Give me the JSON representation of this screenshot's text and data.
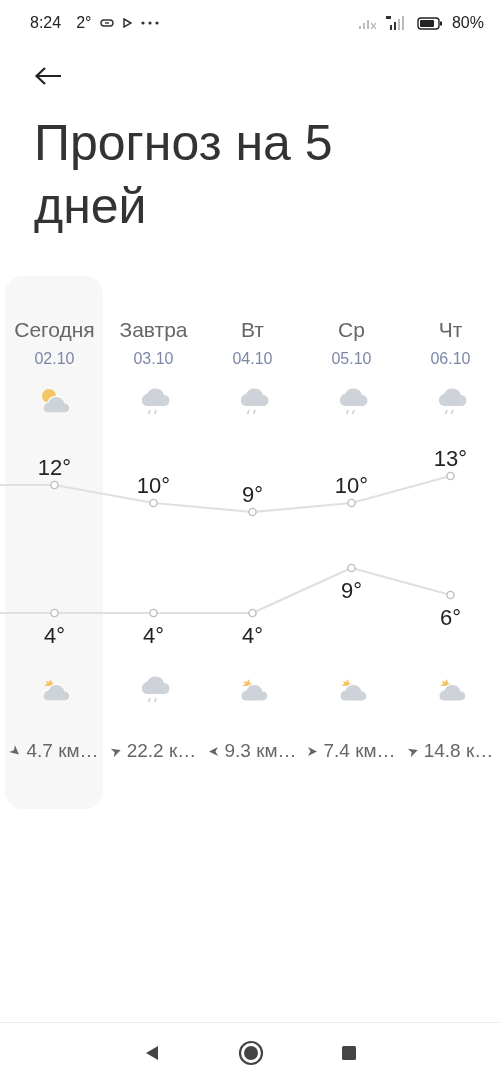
{
  "status_bar": {
    "time": "8:24",
    "temperature": "2°",
    "battery": "80%"
  },
  "title": "Прогноз на 5 дней",
  "days": [
    {
      "name": "Сегодня",
      "date": "02.10",
      "selected": true,
      "high": "12°",
      "low": "4°",
      "day_icon": {
        "kind": "sun-cloud"
      },
      "night_icon": {
        "kind": "night-cloud"
      },
      "wind": "4.7 км…",
      "wind_arrow": {
        "kind": "se"
      }
    },
    {
      "name": "Завтра",
      "date": "03.10",
      "selected": false,
      "high": "10°",
      "low": "4°",
      "day_icon": {
        "kind": "rain"
      },
      "night_icon": {
        "kind": "rain"
      },
      "wind": "22.2 к…",
      "wind_arrow": {
        "kind": "ne"
      }
    },
    {
      "name": "Вт",
      "date": "04.10",
      "selected": false,
      "high": "9°",
      "low": "4°",
      "day_icon": {
        "kind": "rain"
      },
      "night_icon": {
        "kind": "night-cloud"
      },
      "wind": "9.3 км…",
      "wind_arrow": {
        "kind": "w"
      }
    },
    {
      "name": "Ср",
      "date": "05.10",
      "selected": false,
      "high": "10°",
      "low": "9°",
      "day_icon": {
        "kind": "rain"
      },
      "night_icon": {
        "kind": "night-cloud"
      },
      "wind": "7.4 км…",
      "wind_arrow": {
        "kind": "e"
      }
    },
    {
      "name": "Чт",
      "date": "06.10",
      "selected": false,
      "high": "13°",
      "low": "6°",
      "day_icon": {
        "kind": "rain"
      },
      "night_icon": {
        "kind": "night-cloud"
      },
      "wind": "14.8 к…",
      "wind_arrow": {
        "kind": "ne"
      }
    }
  ]
}
